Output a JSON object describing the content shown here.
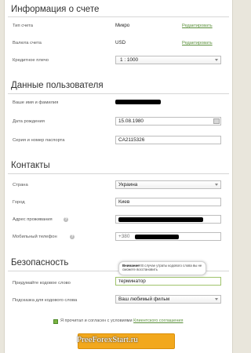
{
  "account": {
    "title": "Информация о счете",
    "type_label": "Тип счета",
    "type_value": "Микро",
    "currency_label": "Валюта счета",
    "currency_value": "USD",
    "edit_label": "Редактировать",
    "leverage_label": "Кредитное плечо",
    "leverage_value": "1 : 1000"
  },
  "personal": {
    "title": "Данные пользователя",
    "name_label": "Ваше имя и фамилия",
    "birth_label": "Дата рождения",
    "birth_value": "15.08.1980",
    "passport_label": "Серия и номер паспорта",
    "passport_value": "CA2115326"
  },
  "contacts": {
    "title": "Контакты",
    "country_label": "Страна",
    "country_value": "Украина",
    "city_label": "Город",
    "city_value": "Киев",
    "address_label": "Адрес проживания",
    "phone_label": "Мобильный телефон",
    "phone_prefix": "+380"
  },
  "security": {
    "title": "Безопасность",
    "codeword_label": "Придумайте кодовое слово",
    "codeword_value": "терминатор",
    "hint_label": "Подсказка для кодового слова",
    "hint_value": "Ваш любимый фильм",
    "tooltip_bold": "Внимание!",
    "tooltip_text": "В случае утраты кодового слова вы не сможете восстановить"
  },
  "agreement": {
    "text": "Я прочитал и согласен с условиями",
    "link": "Клиентского соглашения"
  },
  "watermark": "PreeForexStart.ru",
  "colors": {
    "accent_green": "#5a8f3a",
    "submit_orange": "#f2a81d"
  }
}
